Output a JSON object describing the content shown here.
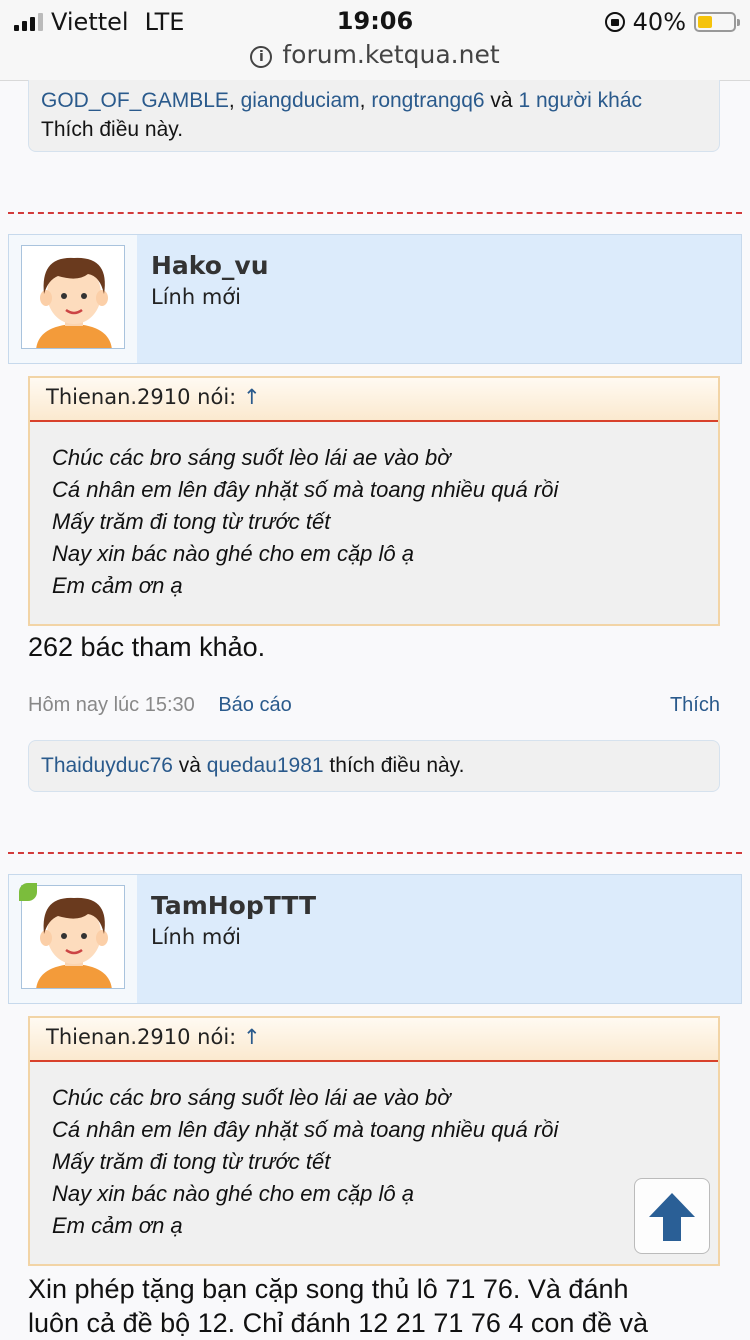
{
  "status_bar": {
    "carrier": "Viettel",
    "network": "LTE",
    "time": "19:06",
    "battery": "40%",
    "battery_level": 0.4
  },
  "browser": {
    "url": "forum.ketqua.net"
  },
  "prev_likes": {
    "users": [
      "GOD_OF_GAMBLE",
      "giangduciam",
      "rongtrangq6"
    ],
    "sep1": ", ",
    "sep2": ", ",
    "and": " và ",
    "others": "1 người khác",
    "suffix": "Thích điều này."
  },
  "posts": [
    {
      "username": "Hako_vu",
      "user_title": "Lính mới",
      "quote_author": "Thienan.2910 nói:",
      "quote_arrow": "↑",
      "quote_lines": [
        "Chúc các bro sáng suốt lèo lái ae vào bờ",
        "Cá nhân em lên đây nhặt số mà toang nhiều quá rồi",
        "Mấy trăm đi tong từ trước tết",
        "Nay xin bác nào ghé cho em cặp lô ạ",
        "Em cảm ơn ạ"
      ],
      "message": "262 bác tham khảo.",
      "date": "Hôm nay lúc 15:30",
      "report": "Báo cáo",
      "like": "Thích",
      "likes": {
        "user1": "Thaiduyduc76",
        "and": " và ",
        "user2": "quedau1981",
        "suffix": " thích điều này."
      }
    },
    {
      "username": "TamHopTTT",
      "user_title": "Lính mới",
      "quote_author": "Thienan.2910 nói:",
      "quote_arrow": "↑",
      "quote_lines": [
        "Chúc các bro sáng suốt lèo lái ae vào bờ",
        "Cá nhân em lên đây nhặt số mà toang nhiều quá rồi",
        "Mấy trăm đi tong từ trước tết",
        "Nay xin bác nào ghé cho em cặp lô ạ",
        "Em cảm ơn ạ"
      ],
      "message_line1": "Xin phép tặng bạn cặp song thủ lô 71 76. Và đánh",
      "message_line2": "luôn cả đề bộ 12. Chỉ đánh 12 21 71 76 4 con đề và"
    }
  ],
  "colors": {
    "link": "#2a5a8c",
    "divider": "#d23b3b",
    "userbar": "#dcebfb",
    "quote_rule": "#d8412b",
    "online": "#7bbd3c"
  }
}
